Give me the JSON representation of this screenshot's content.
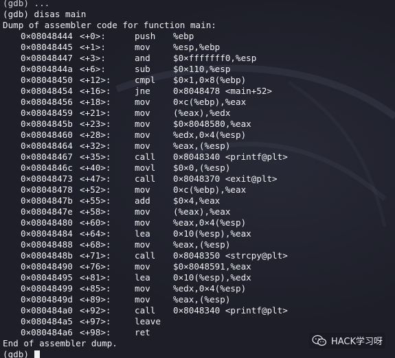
{
  "terminal": {
    "top_partial": "(gdb) ...",
    "command_prompt": "(gdb) disas main",
    "header": "Dump of assembler code for function main:",
    "instructions": [
      {
        "addr": "0×08048444",
        "off": "<+0>:",
        "mnemonic": "push",
        "operands": "%ebp"
      },
      {
        "addr": "0×08048445",
        "off": "<+1>:",
        "mnemonic": "mov",
        "operands": "%esp,%ebp"
      },
      {
        "addr": "0×08048447",
        "off": "<+3>:",
        "mnemonic": "and",
        "operands": "$0×fffffff0,%esp"
      },
      {
        "addr": "0×0804844a",
        "off": "<+6>:",
        "mnemonic": "sub",
        "operands": "$0×110,%esp"
      },
      {
        "addr": "0×08048450",
        "off": "<+12>:",
        "mnemonic": "cmpl",
        "operands": "$0×1,0×8(%ebp)"
      },
      {
        "addr": "0×08048454",
        "off": "<+16>:",
        "mnemonic": "jne",
        "operands": "0×8048478 <main+52>"
      },
      {
        "addr": "0×08048456",
        "off": "<+18>:",
        "mnemonic": "mov",
        "operands": "0×c(%ebp),%eax"
      },
      {
        "addr": "0×08048459",
        "off": "<+21>:",
        "mnemonic": "mov",
        "operands": "(%eax),%edx"
      },
      {
        "addr": "0×0804845b",
        "off": "<+23>:",
        "mnemonic": "mov",
        "operands": "$0×8048580,%eax"
      },
      {
        "addr": "0×08048460",
        "off": "<+28>:",
        "mnemonic": "mov",
        "operands": "%edx,0×4(%esp)"
      },
      {
        "addr": "0×08048464",
        "off": "<+32>:",
        "mnemonic": "mov",
        "operands": "%eax,(%esp)"
      },
      {
        "addr": "0×08048467",
        "off": "<+35>:",
        "mnemonic": "call",
        "operands": "0×8048340 <printf@plt>"
      },
      {
        "addr": "0×0804846c",
        "off": "<+40>:",
        "mnemonic": "movl",
        "operands": "$0×0,(%esp)"
      },
      {
        "addr": "0×08048473",
        "off": "<+47>:",
        "mnemonic": "call",
        "operands": "0×8048370 <exit@plt>"
      },
      {
        "addr": "0×08048478",
        "off": "<+52>:",
        "mnemonic": "mov",
        "operands": "0×c(%ebp),%eax"
      },
      {
        "addr": "0×0804847b",
        "off": "<+55>:",
        "mnemonic": "add",
        "operands": "$0×4,%eax"
      },
      {
        "addr": "0×0804847e",
        "off": "<+58>:",
        "mnemonic": "mov",
        "operands": "(%eax),%eax"
      },
      {
        "addr": "0×08048480",
        "off": "<+60>:",
        "mnemonic": "mov",
        "operands": "%eax,0×4(%esp)"
      },
      {
        "addr": "0×08048484",
        "off": "<+64>:",
        "mnemonic": "lea",
        "operands": "0×10(%esp),%eax"
      },
      {
        "addr": "0×08048488",
        "off": "<+68>:",
        "mnemonic": "mov",
        "operands": "%eax,(%esp)"
      },
      {
        "addr": "0×0804848b",
        "off": "<+71>:",
        "mnemonic": "call",
        "operands": "0×8048350 <strcpy@plt>"
      },
      {
        "addr": "0×08048490",
        "off": "<+76>:",
        "mnemonic": "mov",
        "operands": "$0×8048591,%eax"
      },
      {
        "addr": "0×08048495",
        "off": "<+81>:",
        "mnemonic": "lea",
        "operands": "0×10(%esp),%edx"
      },
      {
        "addr": "0×08048499",
        "off": "<+85>:",
        "mnemonic": "mov",
        "operands": "%edx,0×4(%esp)"
      },
      {
        "addr": "0×0804849d",
        "off": "<+89>:",
        "mnemonic": "mov",
        "operands": "%eax,(%esp)"
      },
      {
        "addr": "0×080484a0",
        "off": "<+92>:",
        "mnemonic": "call",
        "operands": "0×8048340 <printf@plt>"
      },
      {
        "addr": "0×080484a5",
        "off": "<+97>:",
        "mnemonic": "leave",
        "operands": ""
      },
      {
        "addr": "0×080484a6",
        "off": "<+98>:",
        "mnemonic": "ret",
        "operands": ""
      }
    ],
    "footer": "End of assembler dump.",
    "final_prompt": "(gdb)"
  },
  "watermark": {
    "text": "HACK学习呀",
    "icon": "wechat-icon"
  },
  "colors": {
    "background": "#1d1e28",
    "text": "#f0f0f4"
  }
}
